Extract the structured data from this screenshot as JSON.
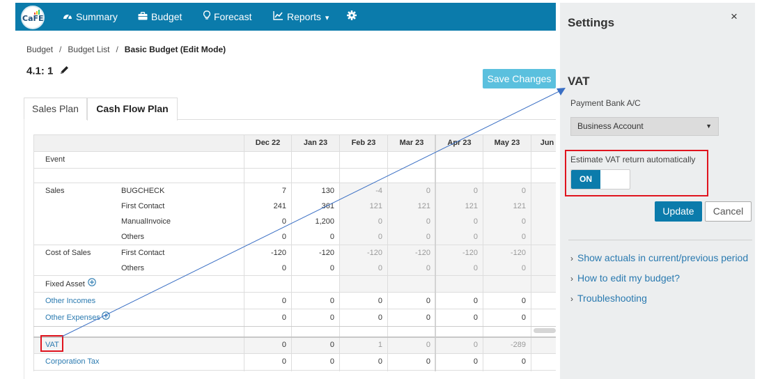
{
  "nav": {
    "logo_text": "CaFE",
    "items": [
      {
        "label": "Summary",
        "icon": "tachometer-icon"
      },
      {
        "label": "Budget",
        "icon": "briefcase-icon"
      },
      {
        "label": "Forecast",
        "icon": "lightbulb-icon"
      },
      {
        "label": "Reports",
        "icon": "line-chart-icon"
      }
    ],
    "reports_caret": "▾",
    "settings_icon": "gear-icon",
    "colors": {
      "bar": "#0b7bab"
    }
  },
  "breadcrumb": {
    "items": [
      "Budget",
      "Budget List"
    ],
    "separator": "/",
    "current": "Basic Budget (Edit Mode)"
  },
  "plan_title": "4.1: 1",
  "save_button": "Save Changes",
  "tabs": [
    {
      "label": "Sales Plan",
      "active": false
    },
    {
      "label": "Cash Flow Plan",
      "active": true
    }
  ],
  "table": {
    "months": [
      "Dec 22",
      "Jan 23",
      "Feb 23",
      "Mar 23",
      "Apr 23",
      "May 23",
      "Jun"
    ],
    "rows": {
      "event": {
        "label": "Event"
      },
      "sales": {
        "label": "Sales",
        "items": [
          {
            "name": "BUGCHECK",
            "values": [
              "7",
              "130",
              "-4",
              "0",
              "0",
              "0"
            ]
          },
          {
            "name": "First Contact",
            "values": [
              "241",
              "361",
              "121",
              "121",
              "121",
              "121"
            ]
          },
          {
            "name": "ManualInvoice",
            "values": [
              "0",
              "1,200",
              "0",
              "0",
              "0",
              "0"
            ]
          },
          {
            "name": "Others",
            "values": [
              "0",
              "0",
              "0",
              "0",
              "0",
              "0"
            ]
          }
        ]
      },
      "cost_of_sales": {
        "label": "Cost of Sales",
        "items": [
          {
            "name": "First Contact",
            "values": [
              "-120",
              "-120",
              "-120",
              "-120",
              "-120",
              "-120"
            ]
          },
          {
            "name": "Others",
            "values": [
              "0",
              "0",
              "0",
              "0",
              "0",
              "0"
            ]
          }
        ]
      },
      "fixed_asset": {
        "label": "Fixed Asset"
      },
      "other_incomes": {
        "label": "Other Incomes",
        "values": [
          "0",
          "0",
          "0",
          "0",
          "0",
          "0"
        ]
      },
      "other_expenses": {
        "label": "Other Expenses",
        "values": [
          "0",
          "0",
          "0",
          "0",
          "0",
          "0"
        ]
      },
      "vat": {
        "label": "VAT",
        "values": [
          "0",
          "0",
          "1",
          "0",
          "0",
          "-289"
        ]
      },
      "corporation_tax": {
        "label": "Corporation Tax",
        "values": [
          "0",
          "0",
          "0",
          "0",
          "0",
          "0"
        ]
      }
    }
  },
  "settings": {
    "title": "Settings",
    "close": "×",
    "vat_title": "VAT",
    "payment_label": "Payment Bank A/C",
    "payment_value": "Business Account",
    "estimate_label": "Estimate VAT return automatically",
    "toggle_state": "ON",
    "update": "Update",
    "cancel": "Cancel",
    "help_links": [
      "Show actuals in current/previous period",
      "How to edit my budget?",
      "Troubleshooting"
    ]
  },
  "annotation_colors": {
    "highlight": "#e0141e",
    "arrow": "#3a6fc4"
  }
}
